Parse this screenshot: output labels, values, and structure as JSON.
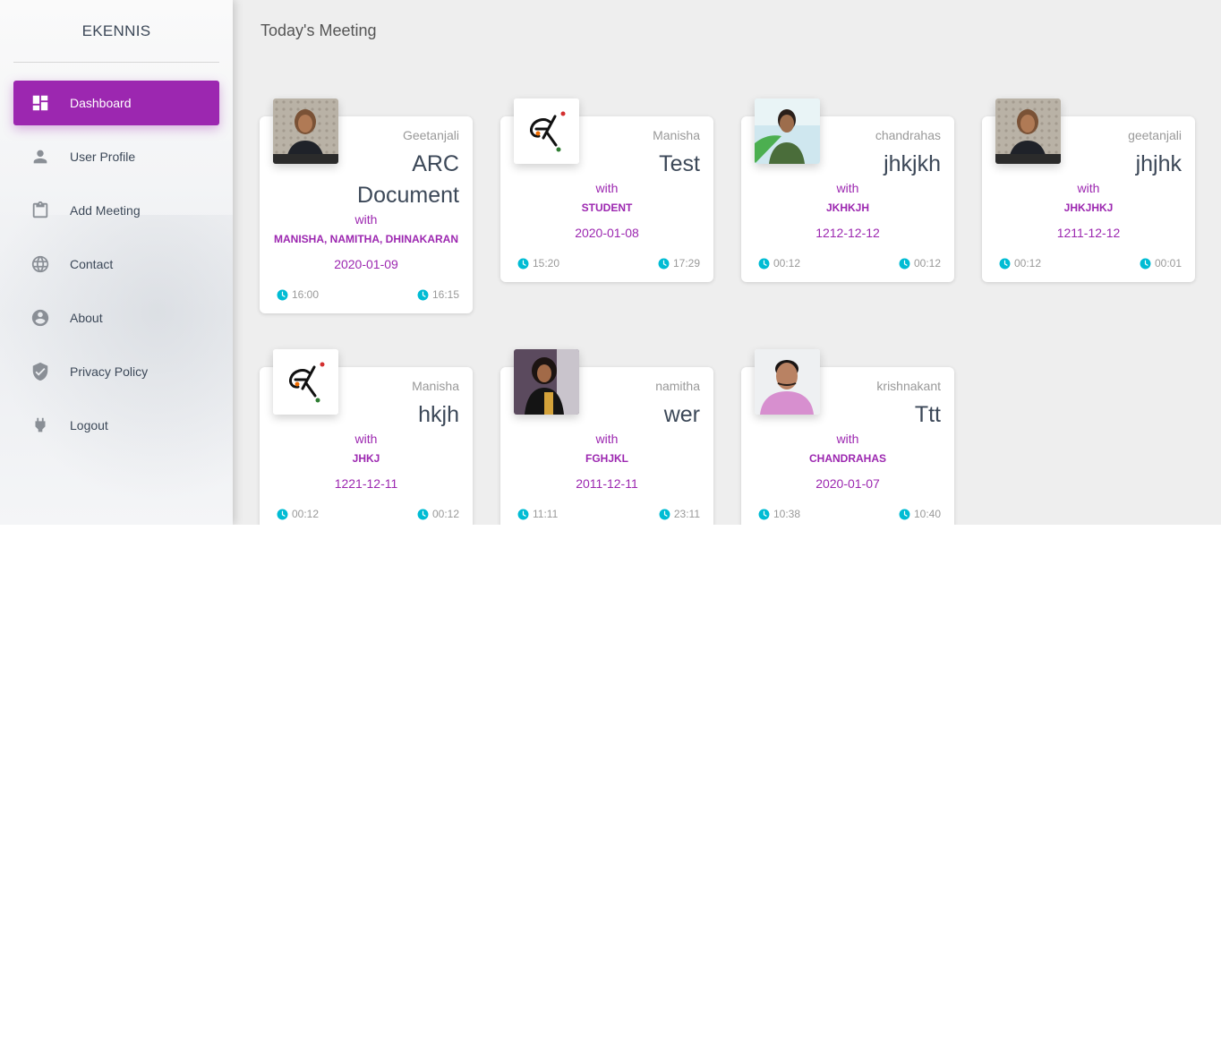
{
  "app": {
    "title": "EKENNIS"
  },
  "nav": {
    "items": [
      {
        "label": "Dashboard",
        "icon": "dashboard-icon",
        "active": true
      },
      {
        "label": "User Profile",
        "icon": "person-icon"
      },
      {
        "label": "Add Meeting",
        "icon": "clipboard-icon"
      },
      {
        "label": "Contact",
        "icon": "globe-icon"
      },
      {
        "label": "About",
        "icon": "account-circle-icon"
      },
      {
        "label": "Privacy Policy",
        "icon": "shield-check-icon"
      },
      {
        "label": "Logout",
        "icon": "plug-icon"
      }
    ]
  },
  "page": {
    "title": "Today's Meeting"
  },
  "colors": {
    "accent": "#9c27b0",
    "clock": "#00bcd4"
  },
  "meetings": [
    {
      "host": "Geetanjali",
      "title": "ARC Document",
      "with_label": "with",
      "attendees": "MANISHA, NAMITHA, DHINAKARAN",
      "date": "2020-01-09",
      "start": "16:00",
      "end": "16:15",
      "avatar": "photo-woman-1"
    },
    {
      "host": "Manisha",
      "title": "Test",
      "with_label": "with",
      "attendees": "STUDENT",
      "date": "2020-01-08",
      "start": "15:20",
      "end": "17:29",
      "avatar": "logo-ek"
    },
    {
      "host": "chandrahas",
      "title": "jhkjkh",
      "with_label": "with",
      "attendees": "JKHKJH",
      "date": "1212-12-12",
      "start": "00:12",
      "end": "00:12",
      "avatar": "photo-man-1"
    },
    {
      "host": "geetanjali",
      "title": "jhjhk",
      "with_label": "with",
      "attendees": "JHKJHKJ",
      "date": "1211-12-12",
      "start": "00:12",
      "end": "00:01",
      "avatar": "photo-woman-1"
    },
    {
      "host": "Manisha",
      "title": "hkjh",
      "with_label": "with",
      "attendees": "JHKJ",
      "date": "1221-12-11",
      "start": "00:12",
      "end": "00:12",
      "avatar": "logo-ek"
    },
    {
      "host": "namitha",
      "title": "wer",
      "with_label": "with",
      "attendees": "FGHJKL",
      "date": "2011-12-11",
      "start": "11:11",
      "end": "23:11",
      "avatar": "photo-woman-2"
    },
    {
      "host": "krishnakant",
      "title": "Ttt",
      "with_label": "with",
      "attendees": "CHANDRAHAS",
      "date": "2020-01-07",
      "start": "10:38",
      "end": "10:40",
      "avatar": "photo-man-2"
    }
  ]
}
